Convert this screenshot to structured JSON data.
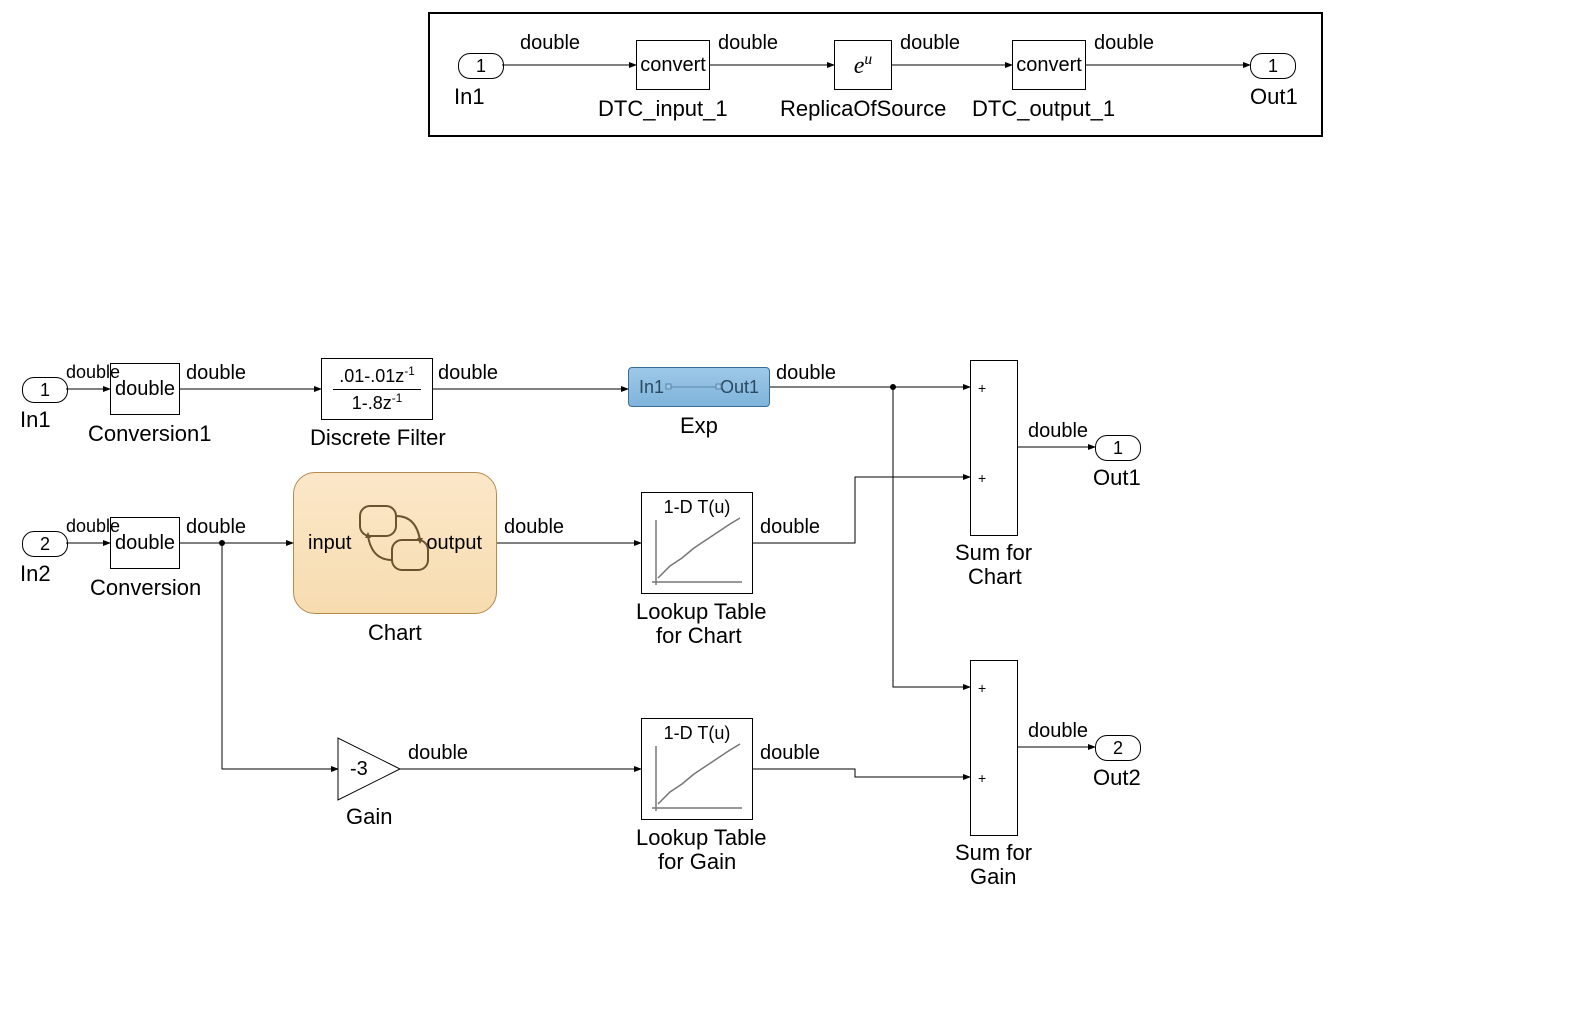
{
  "signal_type": "double",
  "callout": {
    "in_port": {
      "num": "1",
      "label": "In1"
    },
    "dtc_in": {
      "text": "convert",
      "label": "DTC_input_1"
    },
    "replica": {
      "text": "eᵘ",
      "label": "ReplicaOfSource"
    },
    "dtc_out": {
      "text": "convert",
      "label": "DTC_output_1"
    },
    "out_port": {
      "num": "1",
      "label": "Out1"
    }
  },
  "main": {
    "in1": {
      "num": "1",
      "label": "In1"
    },
    "in2": {
      "num": "2",
      "label": "In2"
    },
    "conv1": {
      "text": "double",
      "label": "Conversion1"
    },
    "conv2": {
      "text": "double",
      "label": "Conversion"
    },
    "filter": {
      "num": ".01-.01z",
      "num_sup": "-1",
      "den": "1-.8z",
      "den_sup": "-1",
      "label": "Discrete Filter"
    },
    "exp": {
      "in": "In1",
      "out": "Out1",
      "label": "Exp"
    },
    "chart": {
      "in": "input",
      "out": "output",
      "label": "Chart"
    },
    "lut_chart": {
      "title": "1-D T(u)",
      "label_line1": "Lookup Table",
      "label_line2": "for Chart"
    },
    "lut_gain": {
      "title": "1-D T(u)",
      "label_line1": "Lookup Table",
      "label_line2": "for Gain"
    },
    "gain": {
      "value": "-3",
      "label": "Gain"
    },
    "sum_chart": {
      "label_line1": "Sum for",
      "label_line2": "Chart"
    },
    "sum_gain": {
      "label_line1": "Sum for",
      "label_line2": "Gain"
    },
    "out1": {
      "num": "1",
      "label": "Out1"
    },
    "out2": {
      "num": "2",
      "label": "Out2"
    }
  }
}
